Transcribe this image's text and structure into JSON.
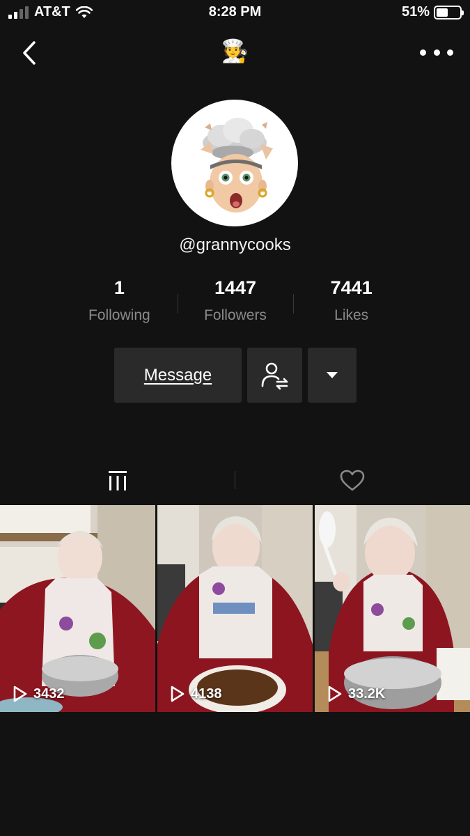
{
  "status_bar": {
    "carrier": "AT&T",
    "time": "8:28 PM",
    "battery_percent": "51%",
    "battery_level": 0.51
  },
  "nav": {
    "title_emoji": "🧑‍🍳",
    "back_icon": "chevron-left-icon",
    "more_icon": "ellipsis-icon"
  },
  "profile": {
    "avatar_icon": "mind-blown-memoji",
    "username": "@grannycooks"
  },
  "stats": [
    {
      "value": "1",
      "label": "Following"
    },
    {
      "value": "1447",
      "label": "Followers"
    },
    {
      "value": "7441",
      "label": "Likes"
    }
  ],
  "actions": {
    "message_label": "Message",
    "follow_icon": "user-follow-swap-icon",
    "more_icon": "dropdown-triangle-icon"
  },
  "tabs": [
    {
      "icon": "videos-grid-icon",
      "active": true
    },
    {
      "icon": "heart-icon",
      "active": false
    }
  ],
  "videos": [
    {
      "views": "3432"
    },
    {
      "views": "4138"
    },
    {
      "views": "33.2K"
    }
  ],
  "colors": {
    "background": "#121212",
    "button": "#2a2a2a",
    "muted_text": "#8a8a8a"
  }
}
